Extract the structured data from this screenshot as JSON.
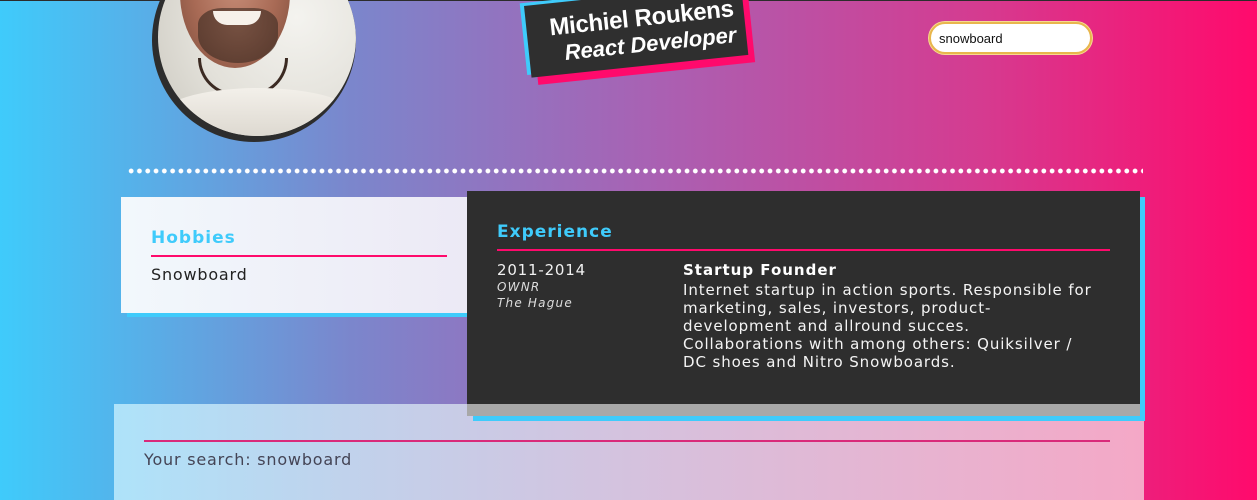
{
  "header": {
    "name": "Michiel Roukens",
    "role": "React Developer"
  },
  "search": {
    "value": "snowboard"
  },
  "hobbies": {
    "title": "Hobbies",
    "items": [
      "Snowboard"
    ]
  },
  "experience": {
    "title": "Experience",
    "entries": [
      {
        "years": "2011-2014",
        "company": "OWNR",
        "city": "The Hague",
        "role": "Startup Founder",
        "description": "Internet startup in action sports. Responsible for marketing, sales, investors, product-development and allround succes. Collaborations with among others: Quiksilver / DC shoes and Nitro Snowboards."
      }
    ]
  },
  "search_result": {
    "text": "Your search: snowboard"
  },
  "colors": {
    "accent_blue": "#3fcbfb",
    "accent_pink": "#ff0a6c",
    "card_dark": "#2e2e2e"
  }
}
